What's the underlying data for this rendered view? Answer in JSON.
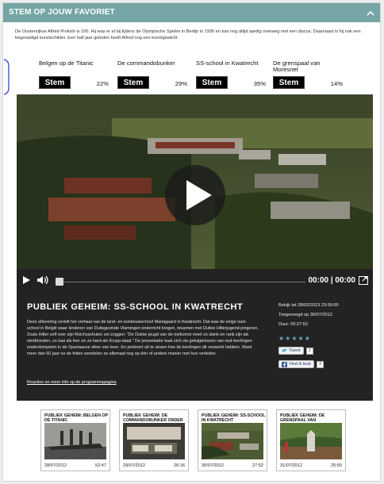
{
  "header": {
    "title": "STEM OP JOUW FAVORIET",
    "toggle_icon": "chevron-up-icon"
  },
  "intro": "De Oostenrijkse Alfred Prokish is 100. Hij was er al bij tijdens de Olympische Spelen in Berlijn in 1936 en kan nog altijd aardig overweg met een discus. Daarnaast is hij ook een begenadigd kunstschilder. Een half jaar geleden heeft Alfred nog een kunstgewicht",
  "poll": {
    "button_label": "Stem",
    "options": [
      {
        "label": "Belgen op de Titanic",
        "percent": "22%"
      },
      {
        "label": "De commandobunker",
        "percent": "29%"
      },
      {
        "label": "SS-school in Kwatrecht",
        "percent": "35%"
      },
      {
        "label": "De grenspaal van Moresnet",
        "percent": "14%"
      }
    ]
  },
  "player": {
    "time": "00:00 | 00:00",
    "progress": 0,
    "play_icon": "play-icon",
    "volume_icon": "volume-icon",
    "fullscreen_icon": "fullscreen-icon"
  },
  "episode": {
    "title": "PUBLIEK GEHEIM: SS-SCHOOL IN KWATRECHT",
    "description": "Deze aflevering vertelt het verhaal van de land- en tuinbouwschool Mariagaard in Kwatrecht. Dat was de enige nazi-school in België waar kinderen van Duitsgezinde Vlamingen onderricht kregen, tesamen met Duitse Hitlerjugend-jongeren. Zoals Hitler zelf over zijn Reichsschulen zei zoggen: \"De Duitse jeugd van de toekomst moet zo slank en rank zijn als windhonden, zo taai als leer en zo hard als Krupp-staal.\" De presentator kaat zich via getuigenissen van oud-leerlingen onderdompelen in de Spartaanse sfeer van toen. En probeert uit te vissen hoe de leerlingen dit verwerkt hebben. Want meer dan 60 jaar na de feiten worstelen ze allemaal nog op één of andere manier met hun verleden.",
    "link": "Reacties en meer info op de programmapagina",
    "available": "Bekijk tot 28/02/2013 23:59:00",
    "added": "Toegevoegd op 30/07/2012",
    "duration": "Duur: 00:27:52",
    "stars": "★★★★★",
    "tweet_label": "Tweet",
    "tweet_count": "1",
    "like_label": "Vind ik leuk",
    "like_count": "3"
  },
  "related": [
    {
      "title": "PUBLIEK GEHEIM: BELGEN OP DE TITANIC",
      "date": "28/07/2012",
      "duration": "52:47"
    },
    {
      "title": "PUBLIEK GEHEIM: DE COMMANDOBUNKER ONDER",
      "date": "29/07/2012",
      "duration": "26:16"
    },
    {
      "title": "PUBLIEK GEHEIM: SS-SCHOOL IN KWATRECHT",
      "date": "30/07/2012",
      "duration": "27:52"
    },
    {
      "title": "PUBLIEK GEHEIM: DE GRENSPAAL VAN",
      "date": "31/07/2012",
      "duration": "25:50"
    }
  ],
  "colors": {
    "header": "#75a5a5",
    "panel": "#232323",
    "button": "#000000",
    "stars": "#6aa2c0"
  }
}
